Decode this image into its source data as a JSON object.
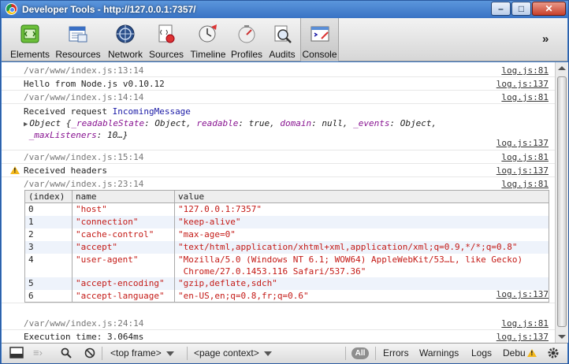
{
  "window": {
    "title": "Developer Tools - http://127.0.0.1:7357/",
    "minimize": "–",
    "maximize": "□",
    "close": "✕"
  },
  "toolbar": {
    "tabs": [
      {
        "label": "Elements",
        "icon": "elements-icon"
      },
      {
        "label": "Resources",
        "icon": "resources-icon"
      },
      {
        "label": "Network",
        "icon": "network-icon"
      },
      {
        "label": "Sources",
        "icon": "sources-icon"
      },
      {
        "label": "Timeline",
        "icon": "timeline-icon"
      },
      {
        "label": "Profiles",
        "icon": "profiles-icon"
      },
      {
        "label": "Audits",
        "icon": "audits-icon"
      },
      {
        "label": "Console",
        "icon": "console-icon",
        "selected": true
      }
    ],
    "overflow": "»"
  },
  "console": {
    "messages": [
      {
        "text": "/var/www/index.js:13:14",
        "source": "log.js:81"
      },
      {
        "text": "Hello from Node.js v0.10.12",
        "source": "log.js:137"
      },
      {
        "text": "/var/www/index.js:14:14",
        "source": "log.js:81"
      },
      {
        "text_prefix": "Received request ",
        "text_type": "IncomingMessage"
      },
      {
        "object_label": "Object",
        "object_open": " {",
        "props": [
          {
            "key": "_readableState",
            "value": "Object"
          },
          {
            "key": "readable",
            "value": "true"
          },
          {
            "key": "domain",
            "value": "null"
          },
          {
            "key": "_events",
            "value": "Object"
          },
          {
            "key": "_maxListeners",
            "value": "10"
          }
        ],
        "object_close": "…}"
      },
      {
        "source": "log.js:137"
      },
      {
        "text": "/var/www/index.js:15:14",
        "source": "log.js:81"
      },
      {
        "text": "Received headers",
        "source": "log.js:137",
        "level": "warning"
      },
      {
        "text": "/var/www/index.js:23:14",
        "source": "log.js:81"
      },
      {
        "source": "log.js:137"
      },
      {
        "text": "/var/www/index.js:24:14",
        "source": "log.js:81"
      },
      {
        "text": "Execution time: 3.064ms",
        "source": "log.js:137"
      }
    ],
    "table": {
      "columns": [
        "(index)",
        "name",
        "value"
      ],
      "rows": [
        {
          "index": "0",
          "name": "\"host\"",
          "value": "\"127.0.0.1:7357\""
        },
        {
          "index": "1",
          "name": "\"connection\"",
          "value": "\"keep-alive\""
        },
        {
          "index": "2",
          "name": "\"cache-control\"",
          "value": "\"max-age=0\""
        },
        {
          "index": "3",
          "name": "\"accept\"",
          "value": "\"text/html,application/xhtml+xml,application/xml;q=0.9,*/*;q=0.8\""
        },
        {
          "index": "4",
          "name": "\"user-agent\"",
          "value": "\"Mozilla/5.0 (Windows NT 6.1; WOW64) AppleWebKit/53…L, like Gecko)",
          "value2": "Chrome/27.0.1453.116 Safari/537.36\""
        },
        {
          "index": "5",
          "name": "\"accept-encoding\"",
          "value": "\"gzip,deflate,sdch\""
        },
        {
          "index": "6",
          "name": "\"accept-language\"",
          "value": "\"en-US,en;q=0.8,fr;q=0.6\""
        }
      ]
    }
  },
  "statusbar": {
    "frame": "<top frame>",
    "context": "<page context>",
    "filter_all": "All",
    "filter_errors": "Errors",
    "filter_warnings": "Warnings",
    "filter_logs": "Logs",
    "filter_debug": "Debu"
  },
  "colors": {
    "titlebar": "#3973c4",
    "string": "#c41a16",
    "property": "#881391",
    "type": "#1a1aa6",
    "warning": "#f3b81c"
  }
}
